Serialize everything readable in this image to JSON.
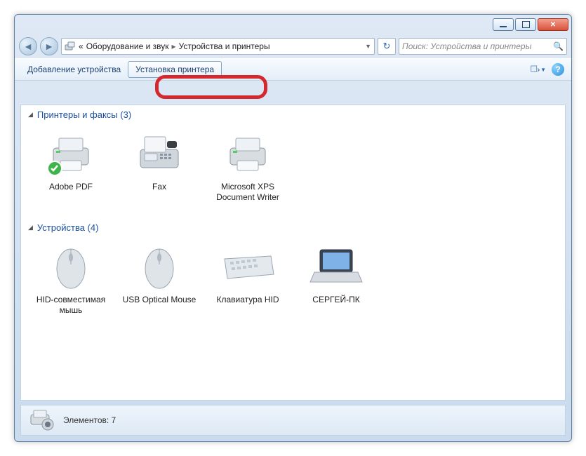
{
  "titlebar": {
    "min": "",
    "max": "",
    "close": ""
  },
  "nav": {
    "bc_prefix": "«",
    "bc_parent": "Оборудование и звук",
    "bc_current": "Устройства и принтеры",
    "refresh_glyph": "↻",
    "search_placeholder": "Поиск: Устройства и принтеры",
    "search_glyph": "🔍"
  },
  "toolbar": {
    "add_device": "Добавление устройства",
    "add_printer": "Установка принтера"
  },
  "groups": [
    {
      "title": "Принтеры и факсы",
      "count": "(3)",
      "items": [
        {
          "label": "Adobe PDF",
          "icon": "printer",
          "default": true
        },
        {
          "label": "Fax",
          "icon": "fax"
        },
        {
          "label": "Microsoft XPS Document Writer",
          "icon": "printer"
        }
      ]
    },
    {
      "title": "Устройства",
      "count": "(4)",
      "items": [
        {
          "label": "HID-совместимая мышь",
          "icon": "mouse"
        },
        {
          "label": "USB Optical Mouse",
          "icon": "mouse"
        },
        {
          "label": "Клавиатура HID",
          "icon": "keyboard"
        },
        {
          "label": "СЕРГЕЙ-ПК",
          "icon": "laptop"
        }
      ]
    }
  ],
  "status": {
    "label": "Элементов: 7"
  }
}
